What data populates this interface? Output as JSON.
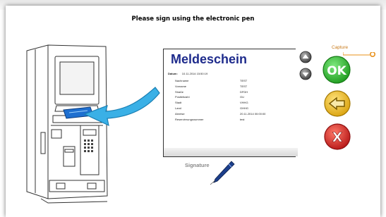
{
  "instruction": "Please sign using the electronic pen",
  "document": {
    "title": "Meldeschein",
    "date_label": "Datum:",
    "date_value": "10.11.2014 15:50:19",
    "fields": [
      {
        "label": "Nachname",
        "value": "TEST"
      },
      {
        "label": "Vorname",
        "value": "TEST"
      },
      {
        "label": "Straße",
        "value": "DFDH"
      },
      {
        "label": "Postleitzahl",
        "value": "GU"
      },
      {
        "label": "Stadt",
        "value": "VHHG"
      },
      {
        "label": "Land",
        "value": "GHHG"
      },
      {
        "label": "Abreise",
        "value": "20.11.2014 00:00:00"
      },
      {
        "label": "Reservierungsnummer",
        "value": "test"
      }
    ]
  },
  "buttons": {
    "capture": "Capture",
    "ok": "OK",
    "scroll_up": "up",
    "scroll_down": "down",
    "back": "back",
    "cancel": "X"
  },
  "signature_label": "Signature",
  "colors": {
    "title_blue": "#1e2b8c",
    "ok_green": "#2fbf2f",
    "back_yellow": "#f0c020",
    "cancel_red": "#d41f1f",
    "arrow_cyan": "#3ab0e6"
  },
  "icons": {
    "kiosk": "kiosk-terminal-illustration",
    "arrow": "pointing-arrow-icon",
    "pen": "pen-icon"
  }
}
